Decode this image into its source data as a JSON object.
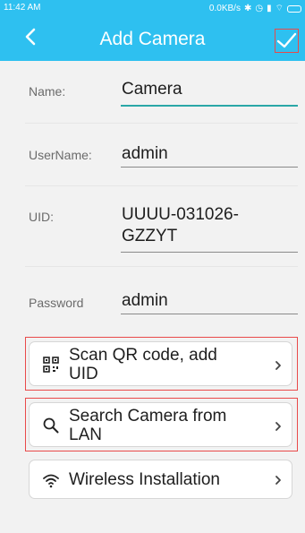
{
  "status_bar": {
    "time": "11:42 AM",
    "network": "0.0KB/s"
  },
  "app_bar": {
    "title": "Add Camera",
    "back_icon": "chevron-left-icon",
    "confirm_icon": "checkmark-icon"
  },
  "form": {
    "fields": [
      {
        "label": "Name:",
        "value": "Camera"
      },
      {
        "label": "UserName:",
        "value": "admin"
      },
      {
        "label": "UID:",
        "value_line1": "UUUU-031026-",
        "value_line2": "GZZYT"
      },
      {
        "label": "Password",
        "value": "admin"
      }
    ]
  },
  "actions": [
    {
      "line1": "Scan QR code, add",
      "line2": "UID",
      "icon": "qr-code-icon"
    },
    {
      "line1": "Search Camera from",
      "line2": "LAN",
      "icon": "search-icon"
    },
    {
      "line1": "Wireless Installation",
      "icon": "wifi-icon"
    }
  ],
  "colors": {
    "header": "#2ec0f0",
    "highlight": "#e94a4a",
    "active_underline": "#2aa7a7"
  }
}
